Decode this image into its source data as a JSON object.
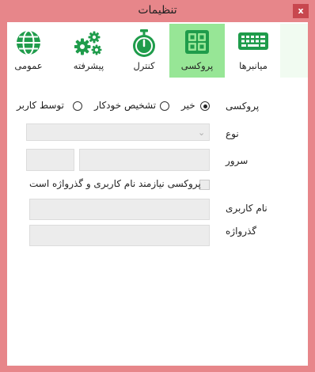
{
  "window": {
    "title": "تنظیمات",
    "close_glyph": "x"
  },
  "toolbar": {
    "items": [
      {
        "label": "میانبرها",
        "icon": "keyboard-icon"
      },
      {
        "label": "پروکسی",
        "icon": "grid-icon",
        "active": true
      },
      {
        "label": "کنترل",
        "icon": "stopwatch-icon"
      },
      {
        "label": "پیشرفته",
        "icon": "gears-icon"
      },
      {
        "label": "عمومی",
        "icon": "globe-icon"
      }
    ],
    "active_color": "#97e696",
    "icon_color": "#1f9c4b"
  },
  "proxy": {
    "label": "پروکسی",
    "options": [
      {
        "label": "خیر",
        "checked": true
      },
      {
        "label": "تشخیص خودکار",
        "checked": false
      },
      {
        "label": "توسط کاربر",
        "checked": false
      }
    ],
    "type_label": "نوع",
    "server_label": "سرور",
    "auth_checkbox_label": "پروکسی نیازمند نام کاربری و گذرواژه است",
    "username_label": "نام کاربری",
    "password_label": "گذرواژه"
  }
}
